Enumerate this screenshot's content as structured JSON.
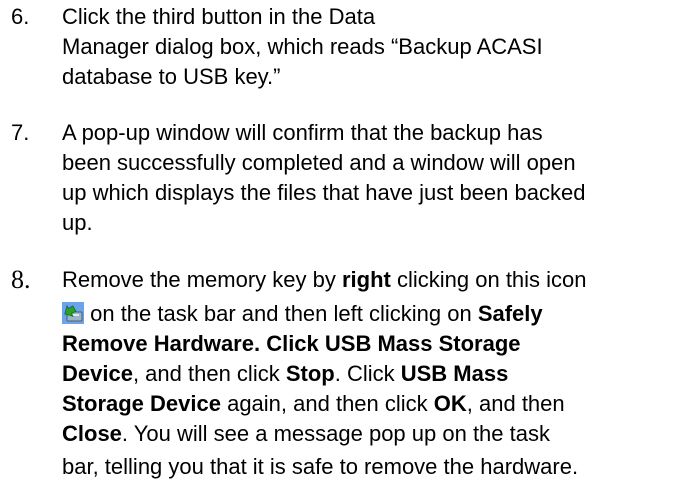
{
  "steps": [
    {
      "number": "6.",
      "lines": [
        "Click the third button in the Data",
        "Manager dialog box, which reads “Backup ACASI",
        "database to USB key.”"
      ]
    },
    {
      "number": "7.",
      "lines": [
        "A pop-up window will confirm that the backup has",
        "been successfully completed and a window will open",
        "up which displays the files that have just been backed",
        "up."
      ]
    },
    {
      "number": "8.",
      "l1_a": "Remove the memory key by ",
      "l1_b": "right",
      "l1_c": " clicking on this icon",
      "l2_a": " on the task bar and then left clicking on ",
      "l2_b": "Safely",
      "l3": "Remove Hardware.  Click USB Mass Storage",
      "l4_a": "Device",
      "l4_b": ", and then click ",
      "l4_c": "Stop",
      "l4_d": ".  Click ",
      "l4_e": "USB Mass",
      "l5_a": "Storage Device",
      "l5_b": " again, and then click ",
      "l5_c": "OK",
      "l5_d": ", and then",
      "l6_a": "Close",
      "l6_b": ".  You will see a message pop up on the task",
      "l7": "bar, telling you that it is safe to remove the hardware."
    }
  ],
  "icon": {
    "name": "safely-remove-hardware-icon",
    "colors": {
      "arrow": "#2e9e2e",
      "device": "#3a7bd5"
    }
  }
}
